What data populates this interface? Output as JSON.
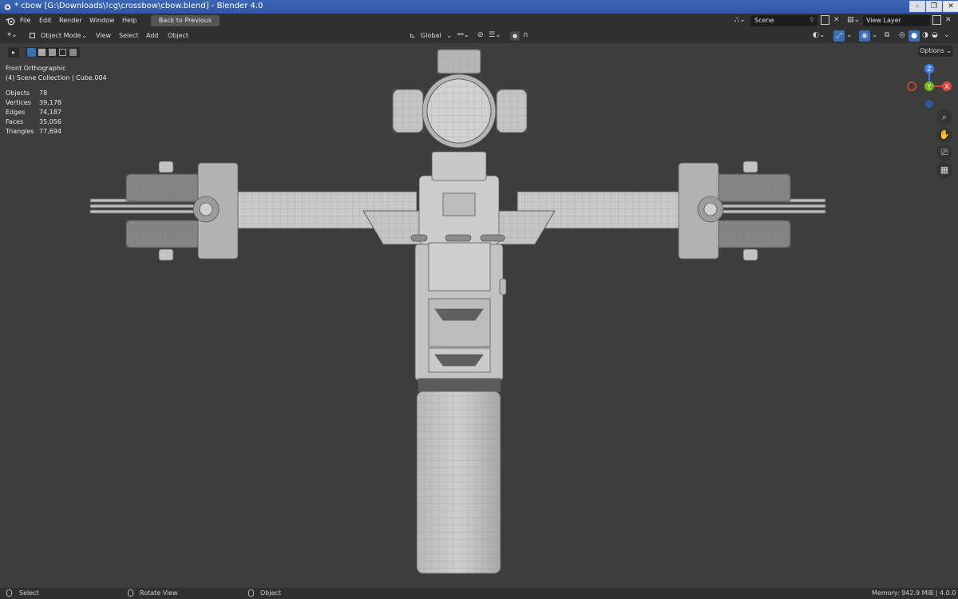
{
  "window": {
    "title": "* cbow [G:\\Downloads\\!cg\\crossbow\\cbow.blend] - Blender 4.0",
    "minimize": "–",
    "maximize": "❐",
    "close": "✕"
  },
  "menu": {
    "items": [
      "File",
      "Edit",
      "Render",
      "Window",
      "Help"
    ],
    "back_button": "Back to Previous",
    "scene_field": "Scene",
    "view_layer_field": "View Layer"
  },
  "header": {
    "mode": "Object Mode",
    "menus": [
      "View",
      "Select",
      "Add",
      "Object"
    ],
    "transform_orientation": "Global",
    "options": "Options"
  },
  "viewport": {
    "view_name": "Front Orthographic",
    "collection": "(4) Scene Collection | Cube.004",
    "stats": [
      {
        "label": "Objects",
        "value": "78"
      },
      {
        "label": "Vertices",
        "value": "39,178"
      },
      {
        "label": "Edges",
        "value": "74,187"
      },
      {
        "label": "Faces",
        "value": "35,056"
      },
      {
        "label": "Triangles",
        "value": "77,694"
      }
    ],
    "gizmo": {
      "z": "Z",
      "y": "Y",
      "x": "X"
    }
  },
  "status": {
    "select": "Select",
    "rotate": "Rotate View",
    "object": "Object",
    "memory": "Memory: 942.9 MiB | 4.0.0"
  },
  "colors": {
    "title_blue": "#2f57a6",
    "viewport_bg": "#3d3d3d",
    "axis_x": "#e0453c",
    "axis_y": "#79b51a",
    "axis_z": "#3d7ce6"
  }
}
